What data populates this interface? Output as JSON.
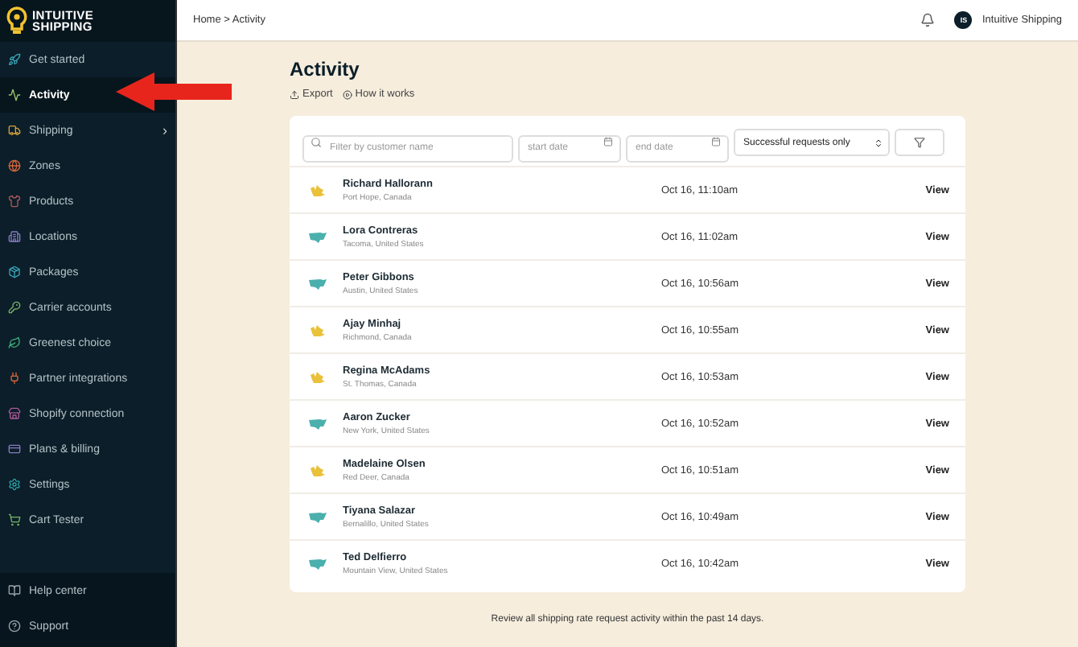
{
  "brand": {
    "line1": "INTUITIVE",
    "line2": "SHIPPING"
  },
  "sidebar": {
    "items": [
      {
        "label": "Get started",
        "selected": false
      },
      {
        "label": "Activity",
        "selected": true
      },
      {
        "label": "Shipping",
        "selected": false,
        "chevron": "›"
      },
      {
        "label": "Zones",
        "selected": false
      },
      {
        "label": "Products",
        "selected": false
      },
      {
        "label": "Locations",
        "selected": false
      },
      {
        "label": "Packages",
        "selected": false
      },
      {
        "label": "Carrier accounts",
        "selected": false
      },
      {
        "label": "Greenest choice",
        "selected": false
      },
      {
        "label": "Partner integrations",
        "selected": false
      },
      {
        "label": "Shopify connection",
        "selected": false
      },
      {
        "label": "Plans & billing",
        "selected": false
      },
      {
        "label": "Settings",
        "selected": false
      },
      {
        "label": "Cart Tester",
        "selected": false
      }
    ],
    "footer": [
      {
        "label": "Help center"
      },
      {
        "label": "Support"
      }
    ]
  },
  "breadcrumb": [
    "Home",
    "Activity"
  ],
  "breadcrumb_separator": ">",
  "user": {
    "initials": "IS",
    "name": "Intuitive Shipping"
  },
  "page": {
    "title": "Activity",
    "actions": [
      "Export",
      "How it works"
    ]
  },
  "filters": {
    "search_placeholder": "Filter by customer name",
    "start_placeholder": "start date",
    "end_placeholder": "end date",
    "status": "Successful requests only"
  },
  "rows": [
    {
      "kind": "canada",
      "name": "Richard Hallorann",
      "place": "Port Hope, Canada",
      "time": "Oct 16, 11:10am",
      "action": "View"
    },
    {
      "kind": "usa",
      "name": "Lora Contreras",
      "place": "Tacoma, United States",
      "time": "Oct 16, 11:02am",
      "action": "View"
    },
    {
      "kind": "usa",
      "name": "Peter Gibbons",
      "place": "Austin, United States",
      "time": "Oct 16, 10:56am",
      "action": "View"
    },
    {
      "kind": "canada",
      "name": "Ajay Minhaj",
      "place": "Richmond, Canada",
      "time": "Oct 16, 10:55am",
      "action": "View"
    },
    {
      "kind": "canada",
      "name": "Regina McAdams",
      "place": "St. Thomas, Canada",
      "time": "Oct 16, 10:53am",
      "action": "View"
    },
    {
      "kind": "usa",
      "name": "Aaron Zucker",
      "place": "New York, United States",
      "time": "Oct 16, 10:52am",
      "action": "View"
    },
    {
      "kind": "canada",
      "name": "Madelaine Olsen",
      "place": "Red Deer, Canada",
      "time": "Oct 16, 10:51am",
      "action": "View"
    },
    {
      "kind": "usa",
      "name": "Tiyana Salazar",
      "place": "Bernalillo, United States",
      "time": "Oct 16, 10:49am",
      "action": "View"
    },
    {
      "kind": "usa",
      "name": "Ted Delfierro",
      "place": "Mountain View, United States",
      "time": "Oct 16, 10:42am",
      "action": "View"
    }
  ],
  "footnote": "Review all shipping rate request activity within the past 14 days."
}
